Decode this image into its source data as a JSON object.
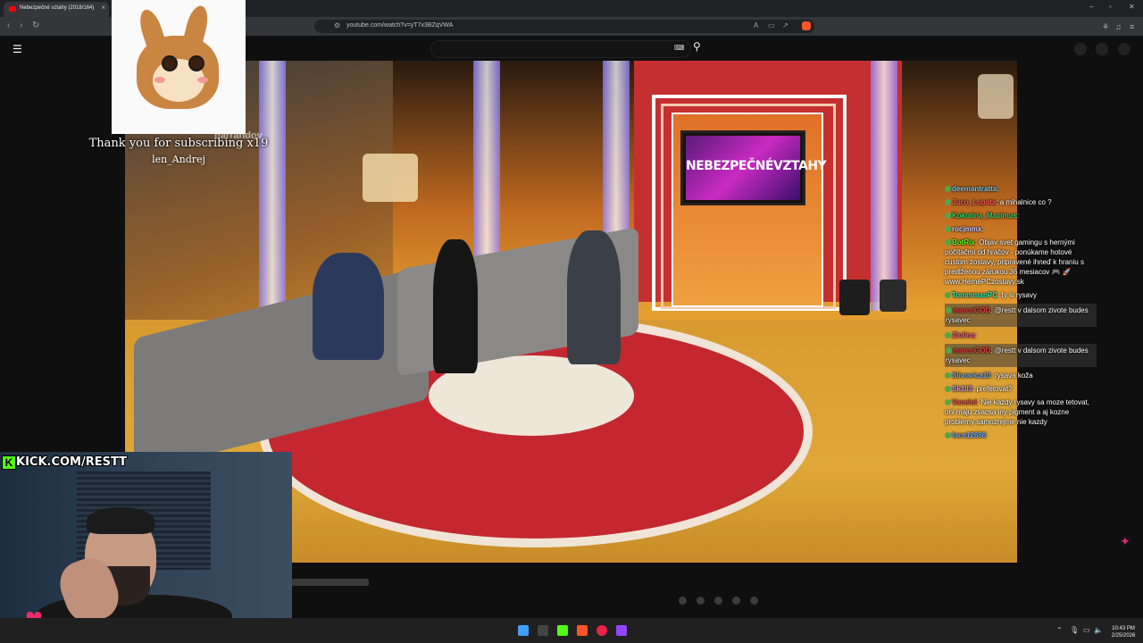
{
  "browser": {
    "tab_title": "Nebezpečné vztahy (2018/164)",
    "tab_close": "×",
    "url": "youtube.com/watch?v=yT7x3BZqVWA",
    "window_controls": [
      "–",
      "▫",
      "✕"
    ]
  },
  "video": {
    "show_logo_text": "NEBEZPEČNÉVZTAHY",
    "watermark": "barrandov"
  },
  "subscription_alert": {
    "message": "Thank you for subscribing x19",
    "username": "len_Andrej"
  },
  "stream_overlay": {
    "kick_label": "KICK.COM/RESTT"
  },
  "chat": [
    {
      "user": "deemantratta",
      "text": "",
      "color": "#7ac7e8",
      "highlight": false
    },
    {
      "user": "Juco_Lopata",
      "text": "a mihalnice co ?",
      "color": "#ff5b5b",
      "highlight": false
    },
    {
      "user": "Kokotina_Maximus",
      "text": "",
      "color": "#2ed36a",
      "highlight": false
    },
    {
      "user": "rocjmmx",
      "text": "",
      "color": "#c7c7ff",
      "highlight": false
    },
    {
      "user": "BotRix",
      "text": "Objav svet gamingu s hernými počítačmi od hráčov - ponúkame hotové custom zostavy, pripravené ihneď k hraniu s predĺženou zárukou 36 mesiacov 🎮 🚀 www.HernePCzostavy.sk",
      "color": "#53fc18",
      "highlight": false
    },
    {
      "user": "TommmanPC",
      "text": "ty si rysavy",
      "color": "#2ee8b0",
      "highlight": false
    },
    {
      "user": "marcoGOD",
      "text": "@restt v dalsom zivote budes rysavec",
      "color": "#e84040",
      "highlight": true
    },
    {
      "user": "Zlolina",
      "text": "",
      "color": "#ff4f8f",
      "highlight": false
    },
    {
      "user": "marcoGOD",
      "text": "@restt v dalsom zivote budes rysavec",
      "color": "#e84040",
      "highlight": true
    },
    {
      "user": "Slivovica10",
      "text": "rysava koža",
      "color": "#6aa6ff",
      "highlight": false
    },
    {
      "user": "Sk1ll3",
      "text": "prefetovat?",
      "color": "#c78bff",
      "highlight": false
    },
    {
      "user": "Vanelol",
      "text": "Nie kazdy rysavy sa moze tetovat, oni maju zvacsa iny pigment a aj kozne problemy samozrejme nie kazdy",
      "color": "#ff4a4a",
      "highlight": false
    },
    {
      "user": "face12686",
      "text": "",
      "color": "#6aa6ff",
      "highlight": false
    }
  ],
  "taskbar": {
    "time": "10:43 PM",
    "date": "2/25/2026"
  },
  "colors": {
    "youtube_red": "#ff0000",
    "kick_green": "#53fc18",
    "brave_orange": "#fb542b"
  }
}
